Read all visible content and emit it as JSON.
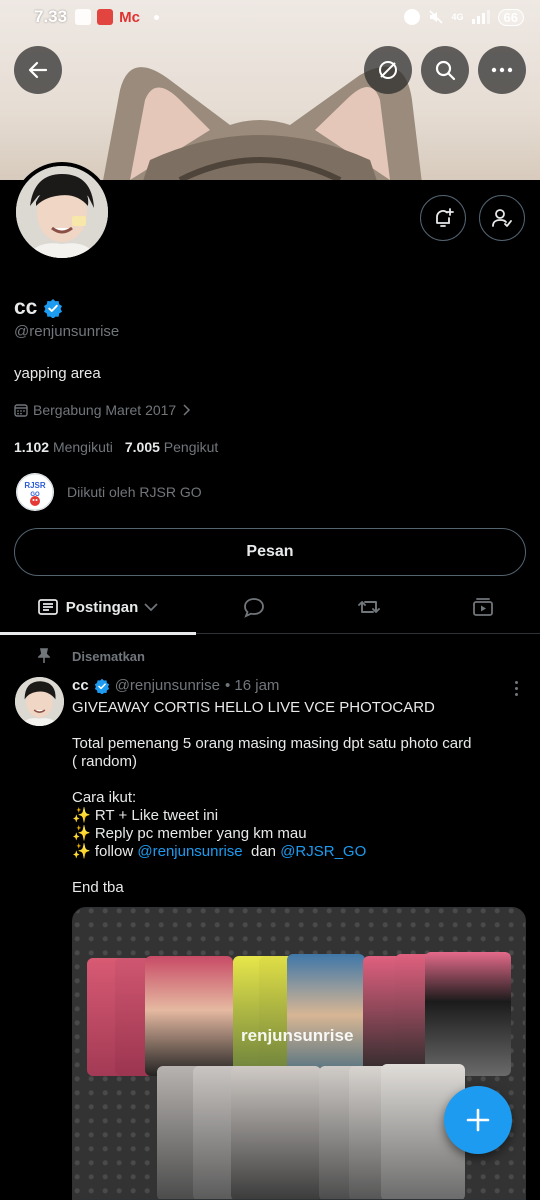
{
  "status_bar": {
    "time": "7.33",
    "carrier_glyph": "Mc",
    "battery": "66",
    "network": "4G"
  },
  "top_bar": {
    "back": "arrow-left-icon",
    "actions": [
      "unlink-icon",
      "search-icon",
      "more-icon"
    ]
  },
  "profile": {
    "display_name": "cc",
    "verified": true,
    "handle": "@renjunsunrise",
    "bio": "yapping area",
    "joined": "Bergabung Maret 2017",
    "following_count": "1.102",
    "following_label": "Mengikuti",
    "followers_count": "7.005",
    "followers_label": "Pengikut",
    "followed_by": "Diikuti oleh RJSR GO",
    "followed_by_avatar_text": "RJSR GO",
    "message_button": "Pesan"
  },
  "tabs": [
    {
      "label": "Postingan",
      "icon": "posts-icon",
      "active": true
    },
    {
      "label": "",
      "icon": "reply-icon"
    },
    {
      "label": "",
      "icon": "repost-icon"
    },
    {
      "label": "",
      "icon": "media-icon"
    }
  ],
  "pinned_post": {
    "pinned_label": "Disematkan",
    "author": "cc",
    "handle": "@renjunsunrise",
    "time": "• 16 jam",
    "lines": {
      "l1": "GIVEAWAY CORTIS HELLO LIVE VCE PHOTOCARD",
      "l2": "Total pemenang 5 orang masing masing dpt satu photo card",
      "l3": "( random)",
      "l4": "Cara ikut:",
      "l5": "✨ RT + Like tweet ini",
      "l6": "✨ Reply pc member yang km mau",
      "l7_prefix": "✨ follow ",
      "l7_link1": "@renjunsunrise",
      "l7_mid": "  dan ",
      "l7_link2": "@RJSR_GO",
      "l8": "End tba"
    },
    "media_watermark": "renjunsunrise"
  },
  "colors": {
    "accent": "#1d9bf0",
    "background": "#000000",
    "muted": "#71767b",
    "border": "#2f3336"
  }
}
